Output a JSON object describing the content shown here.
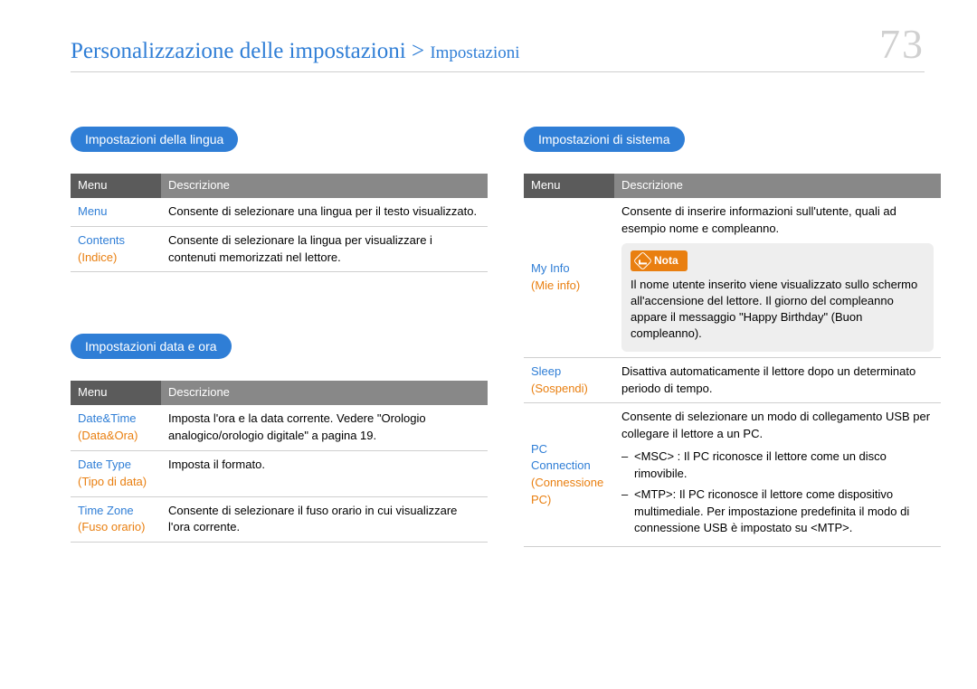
{
  "header": {
    "title_main": "Personalizzazione delle impostazioni",
    "title_separator": " > ",
    "title_sub": "Impostazioni",
    "page_number": "73"
  },
  "left": {
    "sections": [
      {
        "pill": "Impostazioni della lingua",
        "th_menu": "Menu",
        "th_desc": "Descrizione",
        "rows": [
          {
            "menu_en": "Menu",
            "menu_it": "",
            "desc": "Consente di selezionare una lingua per il testo visualizzato."
          },
          {
            "menu_en": "Contents",
            "menu_it": "(Indice)",
            "desc": "Consente di selezionare la lingua per visualizzare i contenuti memorizzati nel lettore."
          }
        ]
      },
      {
        "pill": "Impostazioni data e ora",
        "th_menu": "Menu",
        "th_desc": "Descrizione",
        "rows": [
          {
            "menu_en": "Date&Time",
            "menu_it": "(Data&Ora)",
            "desc": "Imposta l'ora e la data corrente. Vedere \"Orologio analogico/orologio digitale\" a pagina 19."
          },
          {
            "menu_en": "Date Type",
            "menu_it": "(Tipo di data)",
            "desc": "Imposta il formato."
          },
          {
            "menu_en": "Time Zone",
            "menu_it": "(Fuso orario)",
            "desc": "Consente di selezionare il fuso orario in cui visualizzare l'ora corrente."
          }
        ]
      }
    ]
  },
  "right": {
    "pill": "Impostazioni di sistema",
    "th_menu": "Menu",
    "th_desc": "Descrizione",
    "rows": {
      "myinfo": {
        "menu_en": "My Info",
        "menu_it": "(Mie info)",
        "desc_above": "Consente di inserire informazioni sull'utente, quali ad esempio nome e compleanno.",
        "note_label": "Nota",
        "note_text": "Il nome utente inserito viene visualizzato sullo schermo all'accensione del lettore. Il giorno del compleanno appare il messaggio \"Happy Birthday\" (Buon compleanno)."
      },
      "sleep": {
        "menu_en": "Sleep",
        "menu_it": "(Sospendi)",
        "desc": "Disattiva automaticamente il lettore dopo un determinato periodo di tempo."
      },
      "pc": {
        "menu_en": "PC Connection",
        "menu_it": "(Connessione PC)",
        "desc": "Consente di selezionare un modo di collegamento USB per collegare il lettore a un PC.",
        "items": [
          "<MSC> : Il PC riconosce il lettore come un disco rimovibile.",
          "<MTP>: Il PC riconosce il lettore come dispositivo multimediale. Per impostazione predefinita il modo di connessione USB è impostato su <MTP>."
        ]
      }
    }
  }
}
